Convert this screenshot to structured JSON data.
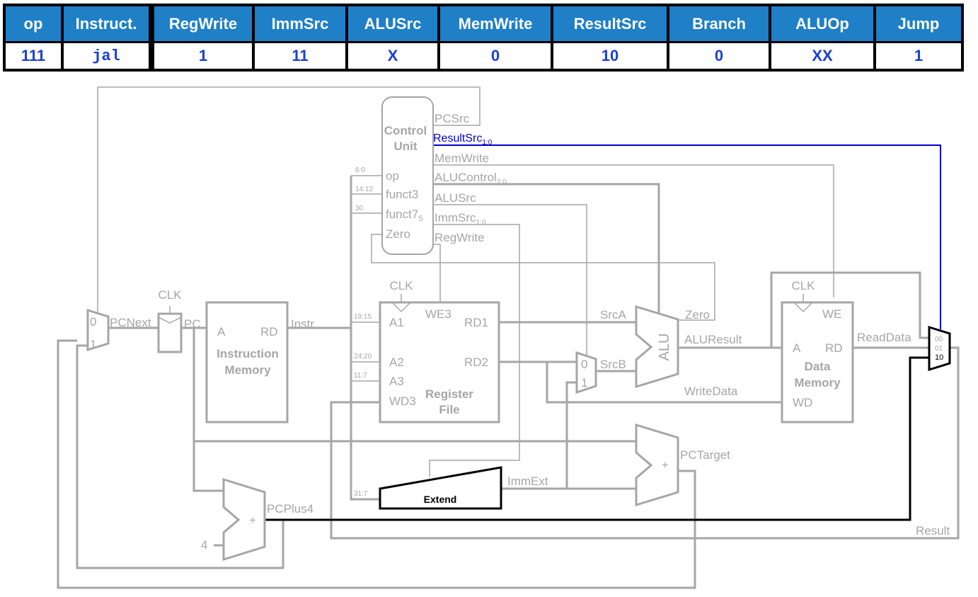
{
  "table": {
    "headers": [
      "op",
      "Instruct.",
      "RegWrite",
      "ImmSrc",
      "ALUSrc",
      "MemWrite",
      "ResultSrc",
      "Branch",
      "ALUOp",
      "Jump"
    ],
    "values": [
      "111",
      "jal",
      "1",
      "11",
      "X",
      "0",
      "10",
      "0",
      "XX",
      "1"
    ]
  },
  "colors": {
    "header_bg": "#1f7fc7",
    "value_text": "#1b3fd6",
    "wire_inactive": "#a6a6a6",
    "wire_active_control": "#0000cc",
    "wire_active_data": "#000000"
  },
  "control_unit": {
    "title1": "Control",
    "title2": "Unit",
    "inputs": {
      "op": "op",
      "funct3": "funct3",
      "funct7": "funct7",
      "funct7_sub": "5",
      "zero": "Zero"
    },
    "outputs": {
      "pcsrc": "PCSrc",
      "resultsrc": "ResultSrc",
      "resultsrc_sub": "1:0",
      "memwrite": "MemWrite",
      "alucontrol": "ALUControl",
      "alucontrol_sub": "2:0",
      "alusrc": "ALUSrc",
      "immsrc": "ImmSrc",
      "immsrc_sub": "1:0",
      "regwrite": "RegWrite"
    }
  },
  "bit_fields": {
    "op": "6:0",
    "funct3": "14:12",
    "funct7": "30",
    "a1": "19:15",
    "a2": "24:20",
    "a3": "11:7",
    "extend": "31:7"
  },
  "blocks": {
    "instr_mem": {
      "title1": "Instruction",
      "title2": "Memory",
      "port_a": "A",
      "port_rd": "RD"
    },
    "reg_file": {
      "title1": "Register",
      "title2": "File",
      "clk": "CLK",
      "we3": "WE3",
      "a1": "A1",
      "a2": "A2",
      "a3": "A3",
      "wd3": "WD3",
      "rd1": "RD1",
      "rd2": "RD2"
    },
    "data_mem": {
      "title1": "Data",
      "title2": "Memory",
      "clk": "CLK",
      "we": "WE",
      "port_a": "A",
      "port_rd": "RD",
      "wd": "WD"
    },
    "alu": {
      "label": "ALU"
    },
    "extend": {
      "label": "Extend"
    },
    "pc_reg": {
      "clk": "CLK"
    },
    "adder_plus": "+"
  },
  "mux": {
    "in0": "0",
    "in1": "1",
    "res00": "00",
    "res01": "01",
    "res10": "10"
  },
  "signals": {
    "pcnext": "PCNext",
    "pc": "PC",
    "instr": "Instr",
    "srca": "SrcA",
    "srcb": "SrcB",
    "zero": "Zero",
    "aluresult": "ALUResult",
    "writedata": "WriteData",
    "readdata": "ReadData",
    "immext": "ImmExt",
    "pctarget": "PCTarget",
    "pcplus4": "PCPlus4",
    "result": "Result",
    "four": "4"
  }
}
